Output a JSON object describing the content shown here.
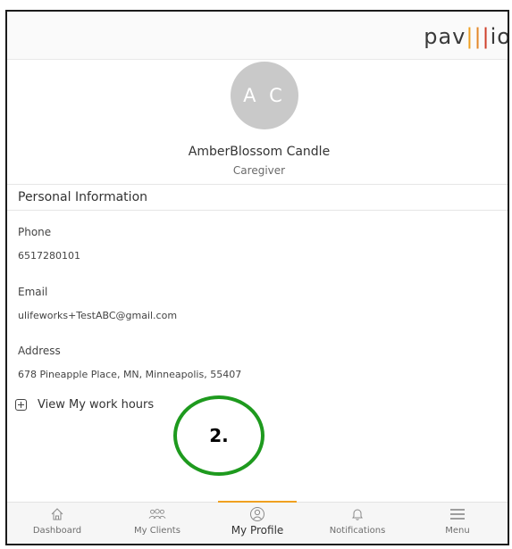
{
  "app": {
    "logo_text": "pavillio"
  },
  "profile": {
    "initials": "A C",
    "name": "AmberBlossom Candle",
    "role": "Caregiver"
  },
  "personal_info": {
    "section_title": "Personal Information",
    "fields": [
      {
        "label": "Phone",
        "value": "6517280101"
      },
      {
        "label": "Email",
        "value": "ulifeworks+TestABC@gmail.com"
      },
      {
        "label": "Address",
        "value": "678 Pineapple Place, MN, Minneapolis, 55407"
      }
    ],
    "work_hours_label": "View My work hours"
  },
  "annotation": {
    "text": "2.",
    "color": "#1e9a1e"
  },
  "bottom_nav": {
    "items": [
      {
        "label": "Dashboard",
        "icon": "home-icon",
        "active": false
      },
      {
        "label": "My Clients",
        "icon": "clients-icon",
        "active": false
      },
      {
        "label": "My Profile",
        "icon": "profile-icon",
        "active": true
      },
      {
        "label": "Notifications",
        "icon": "bell-icon",
        "active": false
      },
      {
        "label": "Menu",
        "icon": "menu-icon",
        "active": false
      }
    ]
  },
  "colors": {
    "accent": "#f0a020",
    "avatar_bg": "#c9c9c9"
  }
}
